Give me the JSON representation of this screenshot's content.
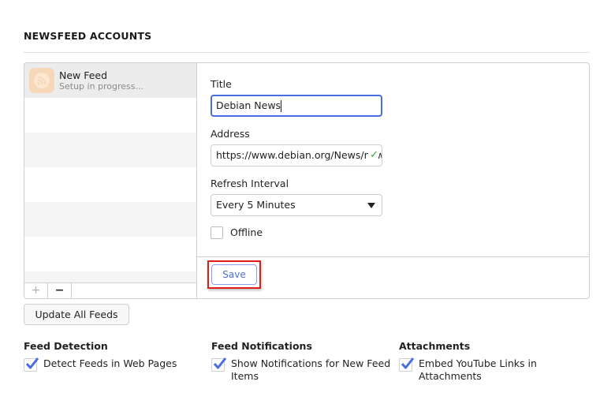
{
  "section": {
    "title": "NEWSFEED ACCOUNTS"
  },
  "feeds": [
    {
      "name": "New Feed",
      "status": "Setup in progress...",
      "icon": "rss-icon",
      "selected": true
    }
  ],
  "list_footer": {
    "add_label": "+",
    "remove_label": "−"
  },
  "form": {
    "title_label": "Title",
    "title_value": "Debian News",
    "address_label": "Address",
    "address_value": "https://www.debian.org/News/news",
    "address_valid_icon": "✓",
    "refresh_label": "Refresh Interval",
    "refresh_value": "Every 5 Minutes",
    "offline_label": "Offline",
    "offline_checked": false,
    "save_label": "Save"
  },
  "update_all_label": "Update All Feeds",
  "options": [
    {
      "title": "Feed Detection",
      "label": "Detect Feeds in Web Pages",
      "checked": true
    },
    {
      "title": "Feed Notifications",
      "label": "Show Notifications for New Feed Items",
      "checked": true
    },
    {
      "title": "Attachments",
      "label": "Embed YouTube Links in Attachments",
      "checked": true
    }
  ],
  "colors": {
    "accent": "#4a6ee0",
    "highlight": "#e01b1b",
    "valid": "#3aa23a",
    "feed_icon": "#f6d7b8"
  }
}
